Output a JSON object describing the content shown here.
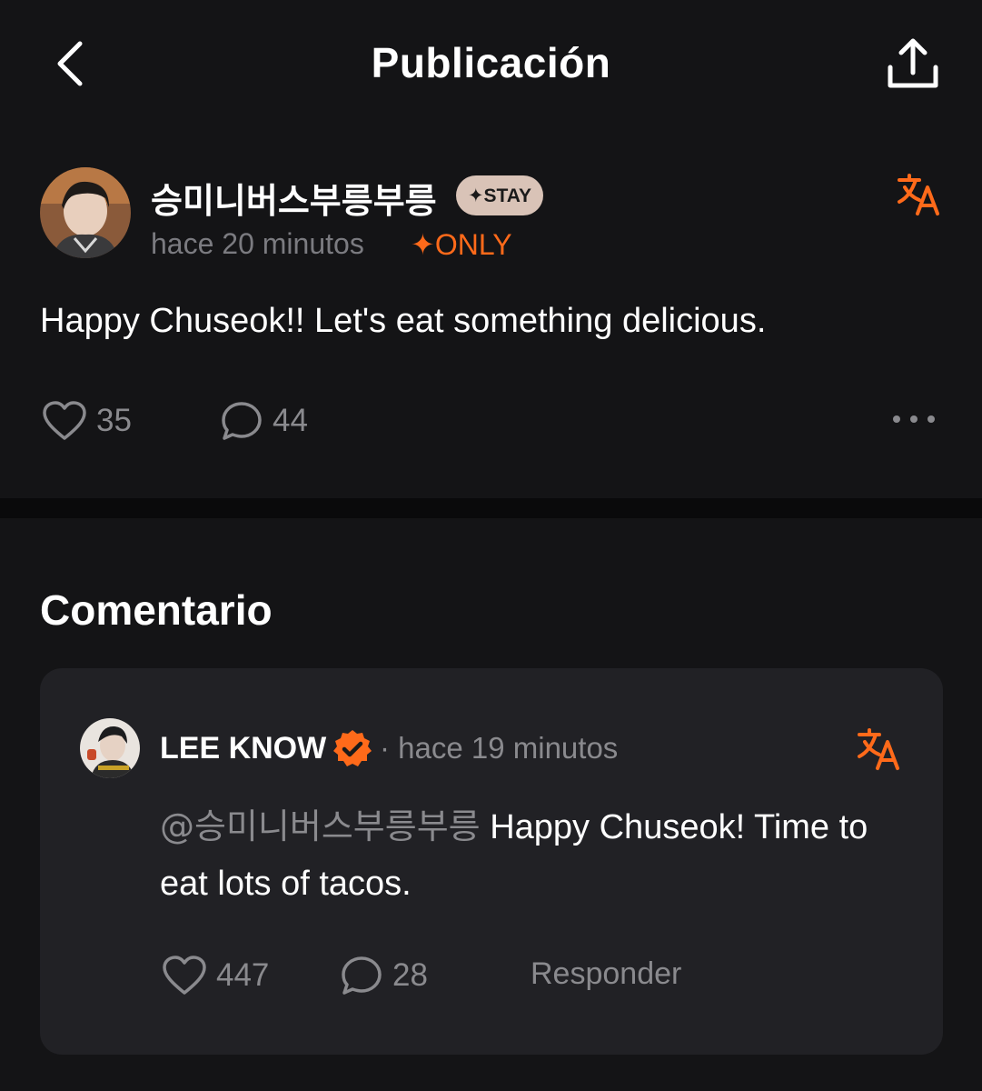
{
  "header": {
    "title": "Publicación",
    "back_icon": "chevron-left-icon",
    "share_icon": "share-upload-icon"
  },
  "post": {
    "author": "승미니버스부릉부릉",
    "badge": "✦STAY",
    "time": "hace 20 minutos",
    "only_label": "✦ONLY",
    "text": "Happy Chuseok!! Let's eat something delicious.",
    "likes": "35",
    "comments": "44",
    "translate_icon": "translate-icon",
    "more_icon": "more-horizontal-icon"
  },
  "comments_section": {
    "title": "Comentario"
  },
  "comment": {
    "author": "LEE KNOW",
    "time": "· hace 19 minutos",
    "mention": "@승미니버스부릉부릉",
    "text": " Happy Chuseok! Time to eat lots of tacos.",
    "likes": "447",
    "replies": "28",
    "reply_label": "Responder"
  },
  "colors": {
    "background": "#141416",
    "card": "#212125",
    "accent": "#ff6a1a",
    "muted": "#8a8a8e",
    "badge_bg": "#d9c3b7"
  }
}
